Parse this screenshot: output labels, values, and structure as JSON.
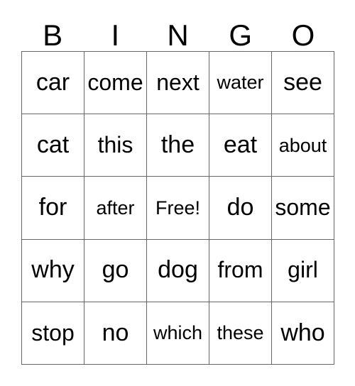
{
  "card": {
    "title": "BINGO",
    "headers": [
      "B",
      "I",
      "N",
      "G",
      "O"
    ],
    "grid": [
      [
        "car",
        "come",
        "next",
        "water",
        "see"
      ],
      [
        "cat",
        "this",
        "the",
        "eat",
        "about"
      ],
      [
        "for",
        "after",
        "Free!",
        "do",
        "some"
      ],
      [
        "why",
        "go",
        "dog",
        "from",
        "girl"
      ],
      [
        "stop",
        "no",
        "which",
        "these",
        "who"
      ]
    ],
    "free_space": {
      "row": 2,
      "col": 2,
      "label": "Free!"
    },
    "colors": {
      "background": "#ffffff",
      "text": "#000000",
      "border": "#666666"
    }
  }
}
